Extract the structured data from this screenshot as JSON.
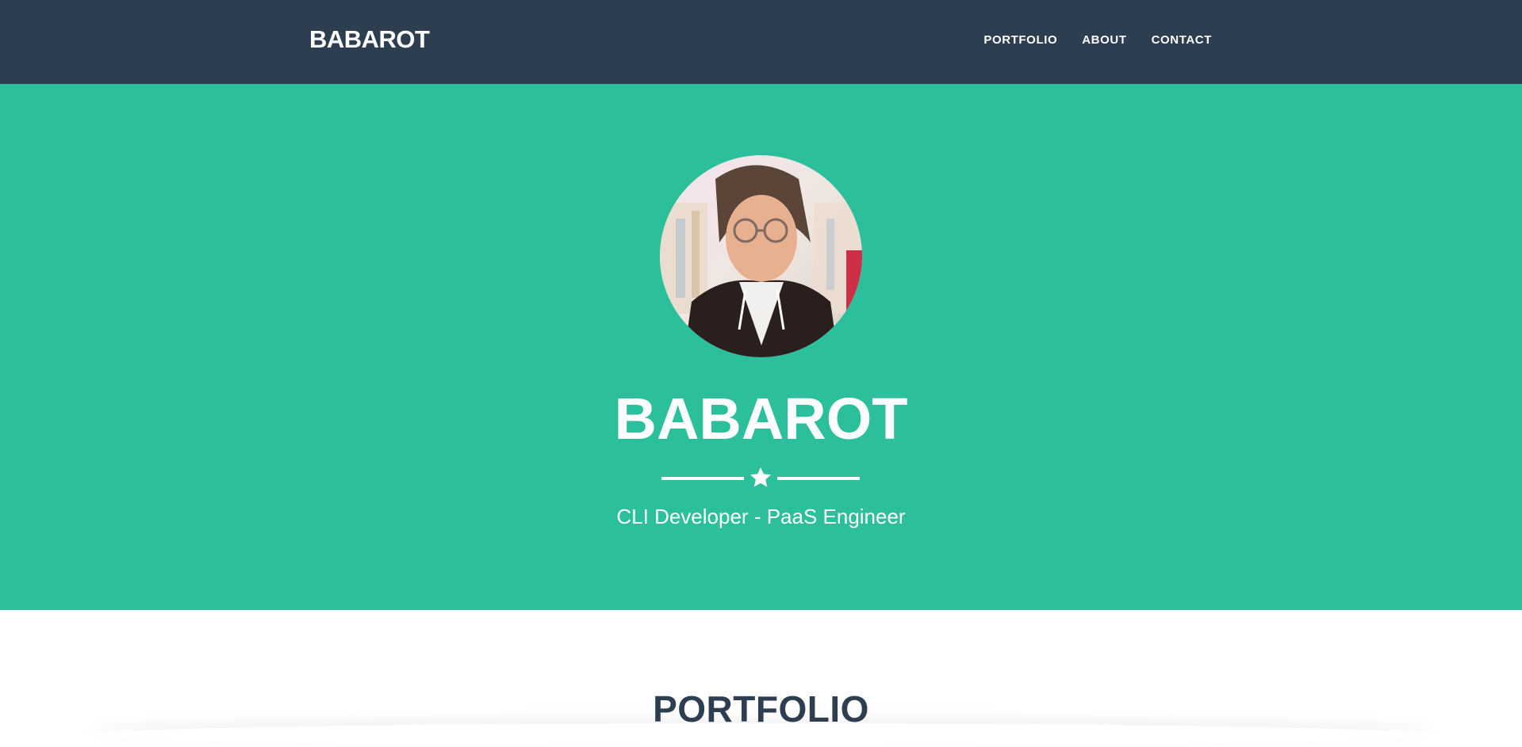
{
  "navbar": {
    "brand": "BABAROT",
    "links": [
      {
        "label": "PORTFOLIO"
      },
      {
        "label": "ABOUT"
      },
      {
        "label": "CONTACT"
      }
    ]
  },
  "hero": {
    "avatar_icon": "profile-photo",
    "title": "BABAROT",
    "divider_icon": "star-icon",
    "subtitle": "CLI Developer - PaaS Engineer"
  },
  "portfolio": {
    "title": "PORTFOLIO"
  },
  "colors": {
    "navbar_bg": "#2c3e50",
    "hero_bg": "#2bbf9b",
    "text_light": "#ffffff",
    "heading_dark": "#2c3e50"
  }
}
